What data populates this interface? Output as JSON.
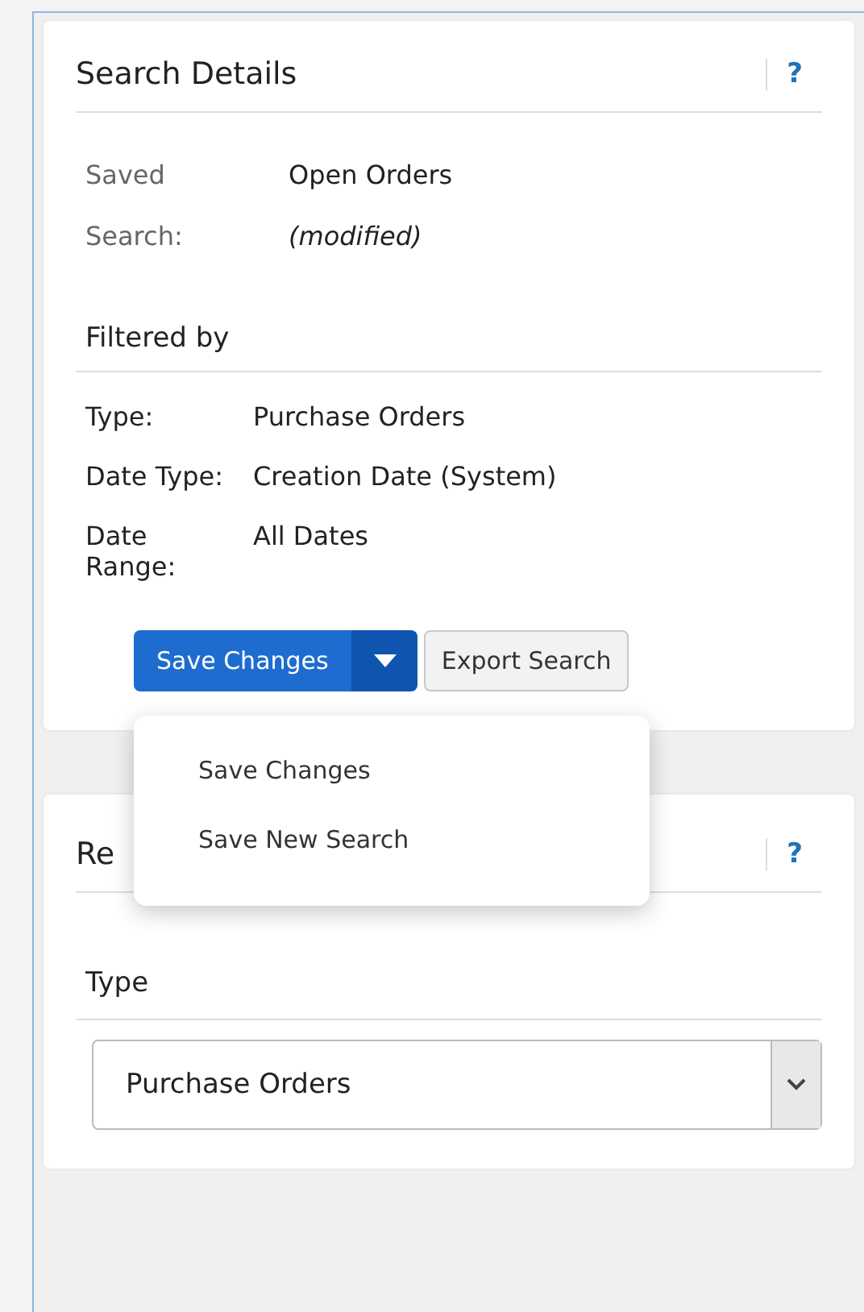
{
  "search_details": {
    "title": "Search Details",
    "help": "?",
    "saved_search": {
      "label": "Saved Search:",
      "value": "Open Orders",
      "note": "(modified)"
    },
    "filtered_by": {
      "heading": "Filtered by",
      "rows": [
        {
          "label": "Type:",
          "value": "Purchase Orders"
        },
        {
          "label": "Date Type:",
          "value": "Creation Date (System)"
        },
        {
          "label": "Date Range:",
          "value": "All Dates"
        }
      ]
    },
    "save_button": {
      "label": "Save Changes",
      "expanded": true
    },
    "export_button": {
      "label": "Export Search"
    },
    "menu": [
      {
        "label": "Save Changes"
      },
      {
        "label": "Save New Search"
      }
    ]
  },
  "second_panel": {
    "title": "Re",
    "help": "?",
    "type_label": "Type",
    "type_select": {
      "value": "Purchase Orders"
    }
  }
}
